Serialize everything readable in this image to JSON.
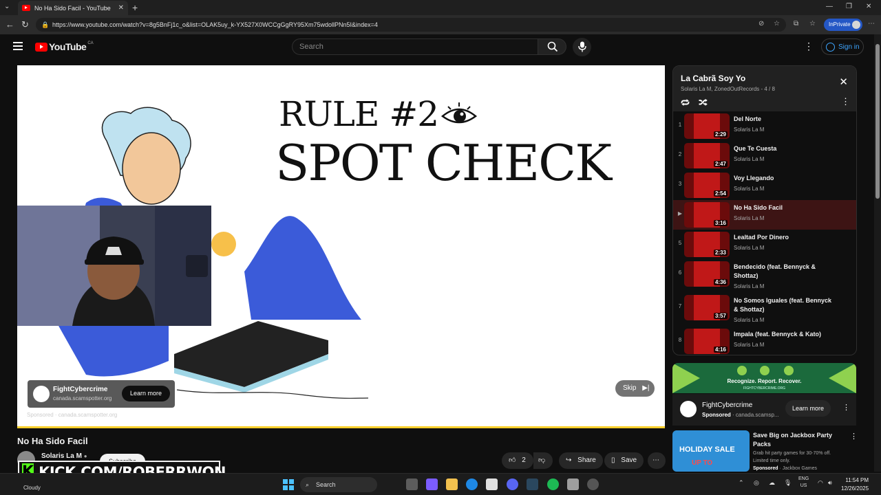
{
  "browser": {
    "tab_title": "No Ha Sido Facil - YouTube",
    "url": "https://www.youtube.com/watch?v=8g5BnFj1c_o&list=OLAK5uy_k-YX527X0WCCgGgRY95Xm75wdollPNn5I&index=4",
    "inprivate_label": "InPrivate"
  },
  "youtube": {
    "logo_text": "YouTube",
    "country_code": "CA",
    "search_placeholder": "Search",
    "signin_label": "Sign in"
  },
  "video": {
    "slide_rule": "RULE #2",
    "slide_heading": "SPOT CHECK",
    "ad_card": {
      "advertiser": "FightCybercrime",
      "domain": "canada.scamspotter.org",
      "cta": "Learn more"
    },
    "sponsored_line": "Sponsored · canada.scamspotter.org",
    "skip_label": "Skip",
    "progress_fraction": 1.0
  },
  "below_video": {
    "title": "No Ha Sido Facil",
    "channel_name": "Solaris La M",
    "subscribe_label": "Subscribe",
    "like_count": "2",
    "share_label": "Share",
    "save_label": "Save"
  },
  "overlay": {
    "kick_text": "KICK.COM/ROBERRWON"
  },
  "playlist": {
    "title": "La Cabrã Soy Yo",
    "subtitle": "Solaris La M, ZonedOutRecords - 4 / 8",
    "items": [
      {
        "index": "1",
        "title": "Del Norte",
        "artist": "Solaris La M",
        "duration": "2:29"
      },
      {
        "index": "2",
        "title": "Que Te Cuesta",
        "artist": "Solaris La M",
        "duration": "2:47"
      },
      {
        "index": "3",
        "title": "Voy Llegando",
        "artist": "Solaris La M",
        "duration": "2:54"
      },
      {
        "index": "▶",
        "title": "No Ha Sido Facil",
        "artist": "Solaris La M",
        "duration": "3:16"
      },
      {
        "index": "5",
        "title": "Lealtad Por Dinero",
        "artist": "Solaris La M",
        "duration": "2:33"
      },
      {
        "index": "6",
        "title": "Bendecido (feat. Bennyck & Shottaz)",
        "artist": "Solaris La M",
        "duration": "4:36"
      },
      {
        "index": "7",
        "title": "No Somos Iguales (feat. Bennyck & Shottaz)",
        "artist": "Solaris La M",
        "duration": "3:57"
      },
      {
        "index": "8",
        "title": "Impala (feat. Bennyck & Kato)",
        "artist": "Solaris La M",
        "duration": "4:16"
      }
    ]
  },
  "side_ads": {
    "banner_text": "Recognize. Report. Recover.",
    "banner_sub": "FIGHTCYBERCRIME.ORG",
    "advertiser": "FightCybercrime",
    "sponsored_label": "Sponsored",
    "domain": "canada.scamsp...",
    "cta": "Learn more",
    "jackbox": {
      "thumb_headline": "HOLIDAY SALE",
      "thumb_sub": "UP TO",
      "title": "Save Big on Jackbox Party Packs",
      "description": "Grab hit party games for 30-70% off. Limited time only.",
      "sponsored_label": "Sponsored",
      "by": "Jackbox Games"
    }
  },
  "taskbar": {
    "weather": "Cloudy",
    "search_label": "Search",
    "lang_top": "ENG",
    "lang_bottom": "US",
    "time": "11:54 PM",
    "date": "12/26/2025"
  }
}
